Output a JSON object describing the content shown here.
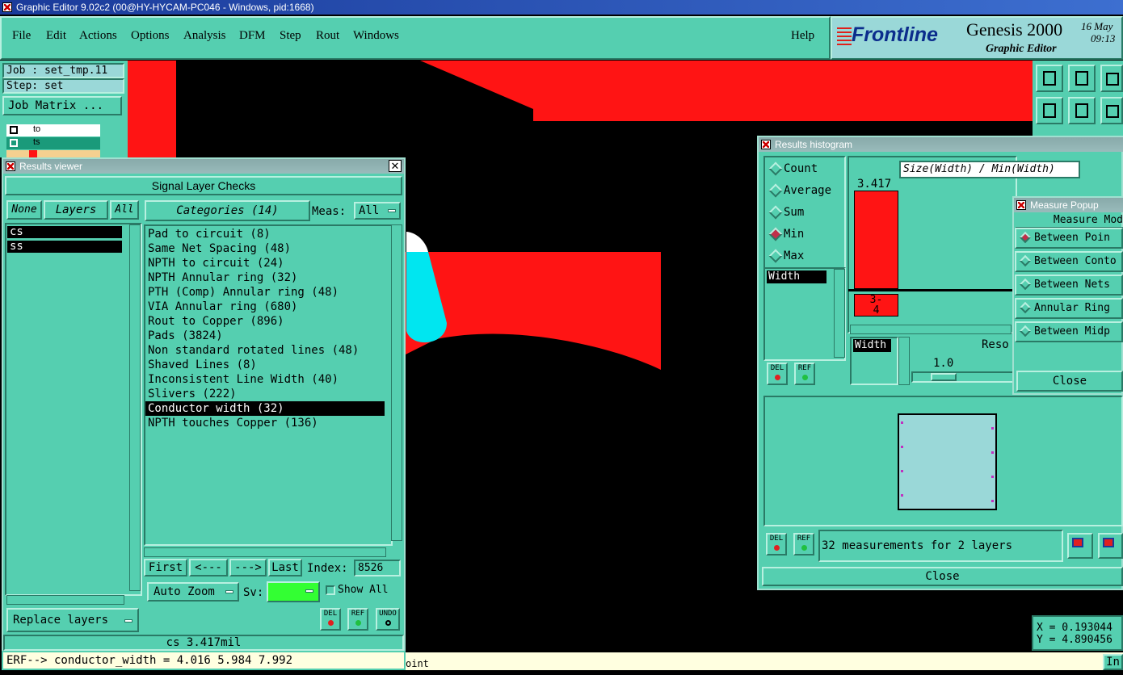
{
  "window": {
    "title": "Graphic Editor 9.02c2 (00@HY-HYCAM-PC046 - Windows, pid:1668)"
  },
  "menu": {
    "items": [
      "File",
      "Edit",
      "Actions",
      "Options",
      "Analysis",
      "DFM",
      "Step",
      "Rout",
      "Windows"
    ],
    "help": "Help"
  },
  "brand": {
    "logo": "Frontline",
    "product": "Genesis 2000",
    "subtitle": "Graphic Editor",
    "date": "16 May",
    "time": "09:13"
  },
  "job": {
    "job_label": "Job : set_tmp.11",
    "step_label": "Step: set",
    "matrix_button": "Job Matrix ..."
  },
  "layers_panel": {
    "rows": [
      "to",
      "ts",
      ""
    ]
  },
  "results_viewer": {
    "title": "Results viewer",
    "header": "Signal Layer Checks",
    "none": "None",
    "layers": "Layers",
    "all": "All",
    "categories_label": "Categories (14)",
    "meas_label": "Meas:",
    "meas_value": "All",
    "layer_items": [
      "cs",
      "ss"
    ],
    "categories": [
      "Pad to circuit (8)",
      "Same Net Spacing (48)",
      "NPTH to circuit (24)",
      "NPTH Annular ring (32)",
      "PTH (Comp) Annular ring (48)",
      "VIA Annular ring (680)",
      "Rout to Copper (896)",
      "Pads (3824)",
      "Non standard rotated lines (48)",
      "Shaved Lines (8)",
      "Inconsistent Line Width (40)",
      "Slivers (222)",
      "Conductor width (32)",
      "NPTH touches Copper (136)"
    ],
    "selected_index": 12,
    "first": "First",
    "prev": "<---",
    "next": "--->",
    "last": "Last",
    "index_label": "Index:",
    "index_value": "8526",
    "auto_zoom": "Auto Zoom",
    "sv_label": "Sv:",
    "show_all": "Show All",
    "replace_layers": "Replace layers",
    "del": "DEL",
    "ref": "REF",
    "undo": "UNDO",
    "status": "cs 3.417mil"
  },
  "erf_line": "ERF--> conductor_width = 4.016 5.984 7.992",
  "bottom_hint": "oint",
  "histogram": {
    "title": "Results histogram",
    "modes": [
      "Count",
      "Average",
      "Sum",
      "Min",
      "Max"
    ],
    "selected_mode": "Min",
    "size_label": "Size(Width) / Min(Width)",
    "bar_value": "3.417",
    "bin_label": "3-\n4",
    "list_item": "Width",
    "list_item2": "Width",
    "res_label": "Reso",
    "res_value": "1.0",
    "del": "DEL",
    "ref": "REF",
    "summary": "32 measurements for 2 layers",
    "close": "Close"
  },
  "measure_popup": {
    "title": "Measure Popup",
    "header": "Measure Mod",
    "options": [
      "Between Poin",
      "Between Conto",
      "Between Nets",
      "Annular Ring",
      "Between Midp"
    ],
    "selected": "Between Poin",
    "close": "Close"
  },
  "coords": {
    "x": "X = 0.193044",
    "y": "Y = 4.890456"
  },
  "corner_button": "In"
}
